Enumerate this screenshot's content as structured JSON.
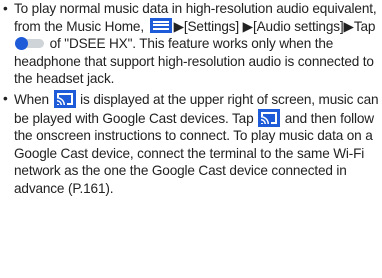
{
  "notes": [
    {
      "bullet": "•",
      "text_1": "To play normal music data in high-resolution audio equivalent, from the Music Home, ",
      "icon_1": "menu-icon",
      "text_2": "▶[Settings] ▶[Audio settings]▶Tap ",
      "icon_2": "toggle-icon",
      "text_3": " of \"DSEE HX\". This feature works only when the headphone that support high-resolution audio is connected to the headset jack."
    },
    {
      "bullet": "•",
      "text_1": "When ",
      "icon_1": "cast-icon",
      "text_2": " is displayed at the upper right of screen, music can be played with Google Cast devices. Tap ",
      "icon_2": "cast-icon",
      "text_3": " and then follow the onscreen instructions to connect. To play music data on a Google Cast device, connect the terminal to the same Wi-Fi network as the one the Google Cast device connected in advance (P.161)."
    }
  ],
  "colors": {
    "icon_blue": "#1e5bd8",
    "toggle_track": "#cfd4d8",
    "text": "#222222"
  }
}
